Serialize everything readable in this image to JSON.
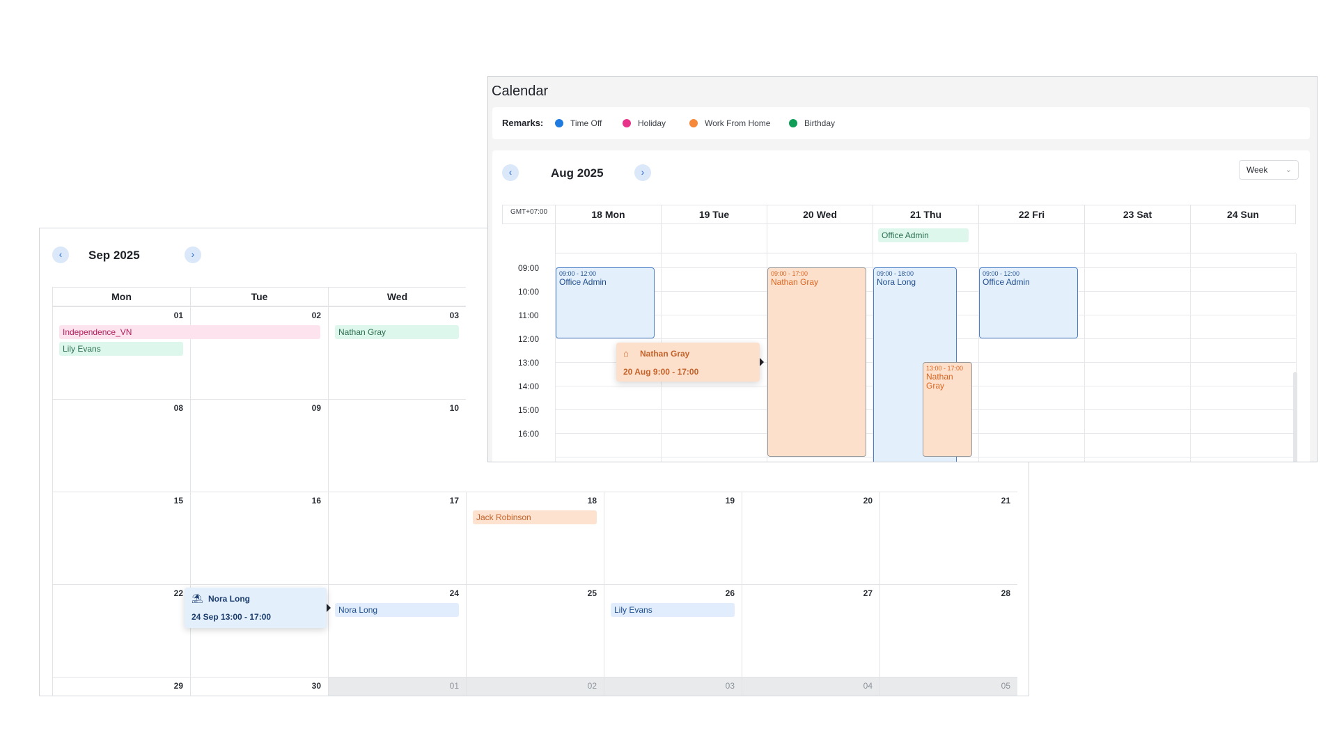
{
  "month_view": {
    "title": "Sep 2025",
    "prev_icon": "chevron-left-icon",
    "next_icon": "chevron-right-icon",
    "weekdays": [
      "Mon",
      "Tue",
      "Wed"
    ],
    "days": {
      "d01": "01",
      "d02": "02",
      "d03": "03",
      "d08": "08",
      "d09": "09",
      "d10": "10",
      "d15": "15",
      "d16": "16",
      "d17": "17",
      "d18": "18",
      "d19": "19",
      "d20": "20",
      "d21": "21",
      "d22": "22",
      "d24": "24",
      "d25": "25",
      "d26": "26",
      "d27": "27",
      "d28": "28",
      "d29": "29",
      "d30": "30",
      "n01": "01",
      "n02": "02",
      "n03": "03",
      "n04": "04",
      "n05": "05"
    },
    "events": {
      "independence": "Independence_VN",
      "lily_1": "Lily Evans",
      "nathan": "Nathan Gray",
      "jack": "Jack Robinson",
      "nora": "Nora Long",
      "lily_2": "Lily Evans"
    },
    "tooltip": {
      "name": "Nora Long",
      "time": "24 Sep 13:00 - 17:00",
      "icon": "beach-umbrella-icon"
    }
  },
  "week_view": {
    "app_title": "Calendar",
    "remarks_label": "Remarks:",
    "legend": [
      {
        "label": "Time Off",
        "color": "#1f7be0"
      },
      {
        "label": "Holiday",
        "color": "#e8338a"
      },
      {
        "label": "Work From Home",
        "color": "#f5883b"
      },
      {
        "label": "Birthday",
        "color": "#0f9d58"
      }
    ],
    "title": "Aug 2025",
    "view_select": "Week",
    "timezone": "GMT+07:00",
    "days": [
      "18 Mon",
      "19 Tue",
      "20 Wed",
      "21 Thu",
      "22 Fri",
      "23 Sat",
      "24 Sun"
    ],
    "hours": [
      "09:00",
      "10:00",
      "11:00",
      "12:00",
      "13:00",
      "14:00",
      "15:00",
      "16:00"
    ],
    "allday_event": "Office Admin",
    "events": {
      "mon": {
        "time": "09:00 - 12:00",
        "name": "Office Admin"
      },
      "wed": {
        "time": "09:00 - 17:00",
        "name": "Nathan Gray"
      },
      "thu_a": {
        "time": "09:00 - 18:00",
        "name": "Nora Long"
      },
      "thu_b": {
        "time": "13:00 - 17:00",
        "name": "Nathan Gray"
      },
      "fri": {
        "time": "09:00 - 12:00",
        "name": "Office Admin"
      }
    },
    "tooltip": {
      "name": "Nathan Gray",
      "time": "20 Aug 9:00 - 17:00",
      "icon": "home-icon"
    }
  }
}
